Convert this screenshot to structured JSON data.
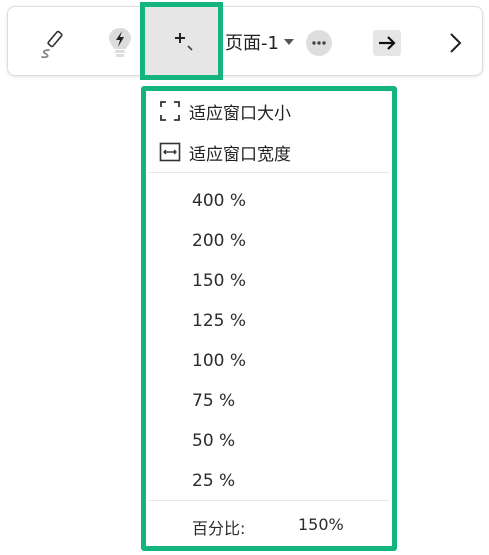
{
  "toolbar": {
    "page_label": "页面-1",
    "icons": {
      "pen": "pen-scribble-icon",
      "lightning": "lightning-bulb-icon",
      "zoom": "zoom-in-icon",
      "more": "more-dots-icon",
      "arrow": "arrow-right-icon",
      "chevron": "chevron-right-icon"
    }
  },
  "menu": {
    "fit_page_label": "适应窗口大小",
    "fit_width_label": "适应窗口宽度",
    "zoom_levels": [
      "400 %",
      "200 %",
      "150 %",
      "125 %",
      "100 %",
      "75 %",
      "50 %",
      "25 %"
    ],
    "percent_label": "百分比:",
    "percent_value": "150%"
  },
  "colors": {
    "highlight": "#13b57c",
    "button_bg": "#e6e6e6"
  }
}
